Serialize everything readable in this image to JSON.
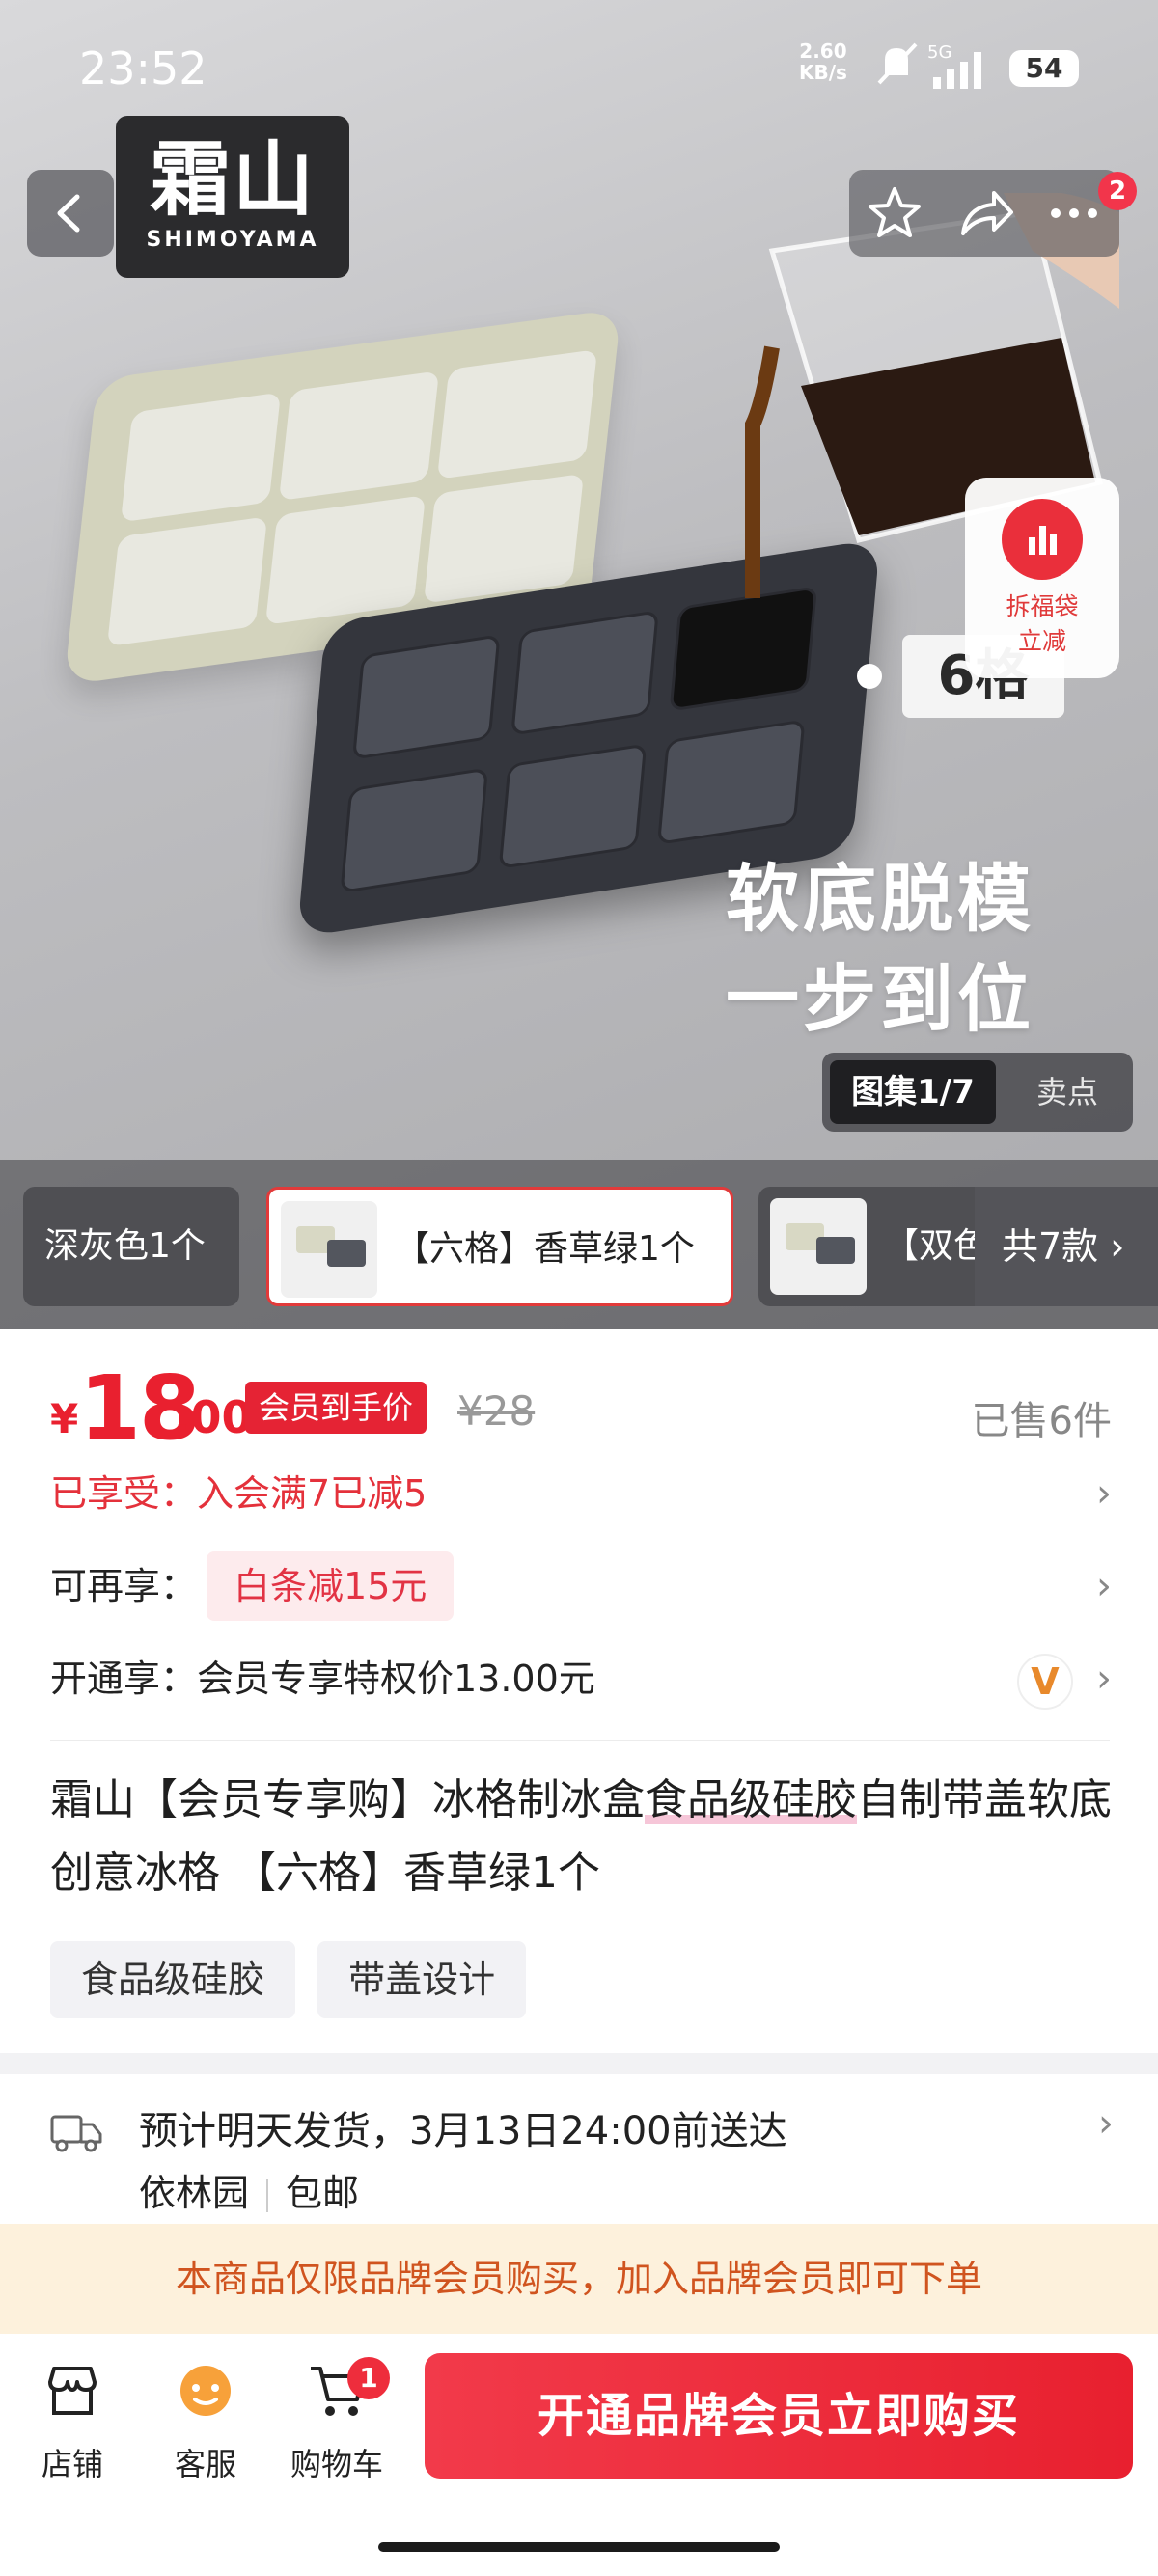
{
  "status_bar": {
    "time": "23:52",
    "net_speed_value": "2.60",
    "net_speed_unit": "KB/s",
    "network": "5G",
    "battery": "54"
  },
  "header": {
    "brand_logo_cn": "霜山",
    "brand_logo_en": "SHIMOYAMA",
    "notification_count": "2"
  },
  "hero": {
    "product_overlay_count": "6格",
    "slogan_line1": "软底脱模",
    "slogan_line2": "一步到位",
    "lucky_bag_line1": "拆福袋",
    "lucky_bag_line2": "立减",
    "gallery_tab": "图集1/7",
    "selling_points_tab": "卖点"
  },
  "variants": {
    "items": [
      {
        "label": "深灰色1个"
      },
      {
        "label": "【六格】香草绿1个"
      },
      {
        "label": "【双色"
      }
    ],
    "more_label": "共7款 ›"
  },
  "price": {
    "currency": "¥",
    "integer": "18",
    "decimal": ".00",
    "member_tag": "会员到手价",
    "original": "¥28",
    "sold": "已售6件"
  },
  "promotions": {
    "enjoyed": "已享受：入会满7已减5",
    "more_label": "可再享：",
    "more_tag": "白条减15元",
    "open_label": "开通享：会员专享特权价13.00元",
    "vip_icon_glyph": "V"
  },
  "title": {
    "part1": "霜山【会员专享购】冰格制冰盒",
    "highlight": "食品级硅胶",
    "part2": "自制带盖软底创意冰格 【六格】香草绿1个"
  },
  "tags": [
    "食品级硅胶",
    "带盖设计"
  ],
  "shipping": {
    "main": "预计明天发货，3月13日24:00前送达",
    "location": "依林园",
    "free_shipping": "包邮"
  },
  "notice": "本商品仅限品牌会员购买，加入品牌会员即可下单",
  "bottom_bar": {
    "store": "店铺",
    "service": "客服",
    "cart": "购物车",
    "cart_count": "1",
    "buy": "开通品牌会员立即购买"
  },
  "colors": {
    "accent_red": "#e9202f",
    "notice_bg": "#fdf1dc",
    "notice_text": "#d0541f"
  }
}
